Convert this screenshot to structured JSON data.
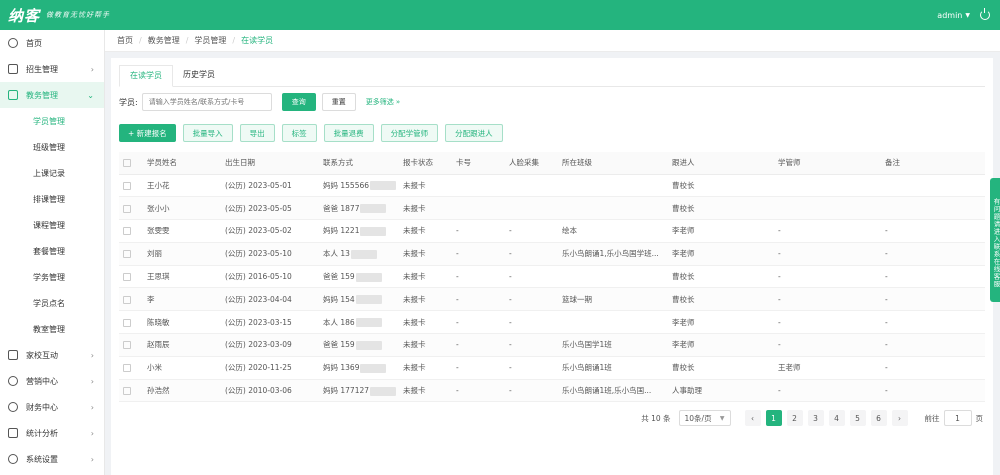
{
  "header": {
    "logo": "纳客",
    "slogan": "做教育无忧好帮手",
    "user": "admin"
  },
  "sidebar": {
    "items": [
      {
        "label": "首页",
        "arrow": ""
      },
      {
        "label": "招生管理",
        "arrow": "›"
      },
      {
        "label": "教务管理",
        "arrow": "⌄"
      }
    ],
    "sub_items": [
      "学员管理",
      "班级管理",
      "上课记录",
      "排课管理",
      "课程管理",
      "套餐管理",
      "学务管理",
      "学员点名",
      "教室管理"
    ],
    "bottom_items": [
      {
        "label": "家校互动",
        "arrow": "›"
      },
      {
        "label": "营销中心",
        "arrow": "›"
      },
      {
        "label": "财务中心",
        "arrow": "›"
      },
      {
        "label": "统计分析",
        "arrow": "›"
      },
      {
        "label": "系统设置",
        "arrow": "›"
      }
    ]
  },
  "breadcrumb": [
    "首页",
    "教务管理",
    "学员管理",
    "在读学员"
  ],
  "tabs": [
    "在读学员",
    "历史学员"
  ],
  "search": {
    "label": "学员:",
    "placeholder": "请输入学员姓名/联系方式/卡号",
    "search_btn": "查询",
    "reset_btn": "重置",
    "more": "更多筛选 »"
  },
  "actions": {
    "primary": "+ 新建报名",
    "buttons": [
      "批量导入",
      "导出",
      "标签",
      "批量退费",
      "分配学管师",
      "分配跟进人"
    ]
  },
  "table": {
    "columns": [
      "学员姓名",
      "出生日期",
      "联系方式",
      "报卡状态",
      "卡号",
      "人脸采集",
      "所在班级",
      "跟进人",
      "学管师",
      "备注"
    ],
    "rows": [
      {
        "name": "王小花",
        "birth": "(公历) 2023-05-01",
        "contact": "妈妈 155566",
        "status": "未报卡",
        "card": "",
        "face": "",
        "class": "",
        "follow": "曹校长",
        "manager": "",
        "note": ""
      },
      {
        "name": "张小小",
        "birth": "(公历) 2023-05-05",
        "contact": "爸爸 1877",
        "status": "未报卡",
        "card": "",
        "face": "",
        "class": "",
        "follow": "曹校长",
        "manager": "",
        "note": ""
      },
      {
        "name": "张雯雯",
        "birth": "(公历) 2023-05-02",
        "contact": "妈妈 1221",
        "status": "未报卡",
        "card": "-",
        "face": "-",
        "class": "绘本",
        "follow": "李老师",
        "manager": "-",
        "note": "-"
      },
      {
        "name": "刘丽",
        "birth": "(公历) 2023-05-10",
        "contact": "本人 13",
        "status": "未报卡",
        "card": "-",
        "face": "-",
        "class": "乐小鸟朗诵1,乐小鸟国学班...",
        "follow": "李老师",
        "manager": "-",
        "note": "-"
      },
      {
        "name": "王思琪",
        "birth": "(公历) 2016-05-10",
        "contact": "爸爸 159",
        "status": "未报卡",
        "card": "-",
        "face": "-",
        "class": "",
        "follow": "曹校长",
        "manager": "-",
        "note": "-"
      },
      {
        "name": "李",
        "birth": "(公历) 2023-04-04",
        "contact": "妈妈 154",
        "status": "未报卡",
        "card": "-",
        "face": "-",
        "class": "篮球一期",
        "follow": "曹校长",
        "manager": "-",
        "note": "-"
      },
      {
        "name": "陈晓敏",
        "birth": "(公历) 2023-03-15",
        "contact": "本人 186",
        "status": "未报卡",
        "card": "-",
        "face": "-",
        "class": "",
        "follow": "李老师",
        "manager": "-",
        "note": "-"
      },
      {
        "name": "赵雨辰",
        "birth": "(公历) 2023-03-09",
        "contact": "爸爸 159",
        "status": "未报卡",
        "card": "-",
        "face": "-",
        "class": "乐小鸟国学1班",
        "follow": "李老师",
        "manager": "-",
        "note": "-"
      },
      {
        "name": "小米",
        "birth": "(公历) 2020-11-25",
        "contact": "妈妈 1369",
        "status": "未报卡",
        "card": "-",
        "face": "-",
        "class": "乐小鸟朗诵1班",
        "follow": "曹校长",
        "manager": "王老师",
        "note": "-"
      },
      {
        "name": "孙浩然",
        "birth": "(公历) 2010-03-06",
        "contact": "妈妈 177127",
        "status": "未报卡",
        "card": "-",
        "face": "-",
        "class": "乐小鸟朗诵1班,乐小鸟国...",
        "follow": "人事助理",
        "manager": "-",
        "note": "-"
      }
    ]
  },
  "pagination": {
    "total": "共 10 条",
    "page_size": "10条/页",
    "prev": "‹",
    "pages": [
      "1",
      "2",
      "3",
      "4",
      "5",
      "6"
    ],
    "next": "›",
    "goto_label": "前往",
    "goto_value": "1",
    "goto_suffix": "页",
    "current_page": 1
  },
  "float_tab": "有问题请进入联系在线客服"
}
